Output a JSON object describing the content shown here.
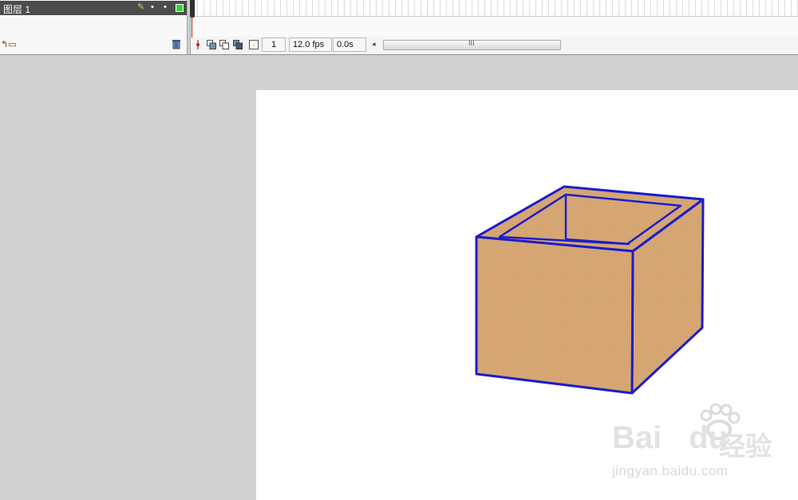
{
  "timeline": {
    "layer": {
      "name": "图层 1",
      "outline_color": "#3ad13a"
    },
    "toolbar": {
      "current_frame": "1",
      "frame_rate": "12.0 fps",
      "elapsed_time": "0.0s",
      "scroll_grip": "III"
    },
    "icons": [
      "pencil-icon",
      "eye-dot-icon",
      "lock-dot-icon",
      "add-layer-icon",
      "trash-icon",
      "center-frame-icon",
      "onion-skin-icon",
      "onion-skin-outline-icon",
      "edit-multiple-frames-icon",
      "onion-markers-icon"
    ]
  },
  "stage": {
    "background": "#ffffff",
    "box": {
      "fill_color": "#d6a774",
      "stroke_color": "#1d1dc8"
    }
  },
  "watermark": {
    "logo_text": "Bai",
    "logo_text_2": "du",
    "brand_text": "经验",
    "url": "jingyan.baidu.com"
  }
}
